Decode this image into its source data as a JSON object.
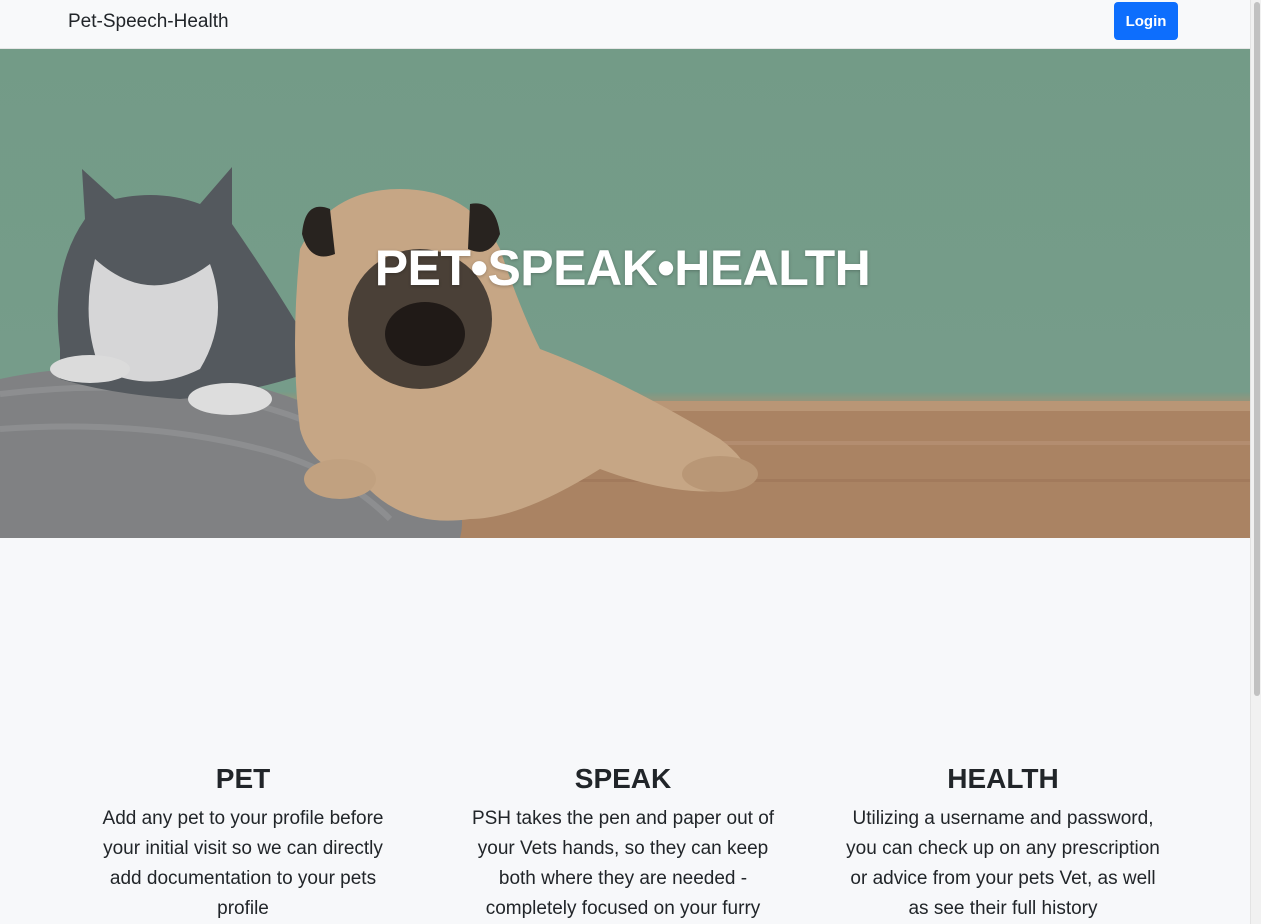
{
  "navbar": {
    "brand": "Pet-Speech-Health",
    "login_label": "Login"
  },
  "hero": {
    "title": "PET•SPEAK•HEALTH",
    "image_alt": "gray cat and pug lying on a knit cushion against a green wall"
  },
  "features": [
    {
      "title": "PET",
      "text": "Add any pet to your profile before your initial visit so we can directly add documentation to your pets profile"
    },
    {
      "title": "SPEAK",
      "text": "PSH takes the pen and paper out of your Vets hands, so they can keep both where they are needed - completely focused on your furry"
    },
    {
      "title": "HEALTH",
      "text": "Utilizing a username and password, you can check up on any prescription or advice from your pets Vet, as well as see their full history"
    }
  ],
  "colors": {
    "primary": "#0d6efd",
    "background": "#f7f8fa",
    "hero_wall": "#7da993"
  }
}
